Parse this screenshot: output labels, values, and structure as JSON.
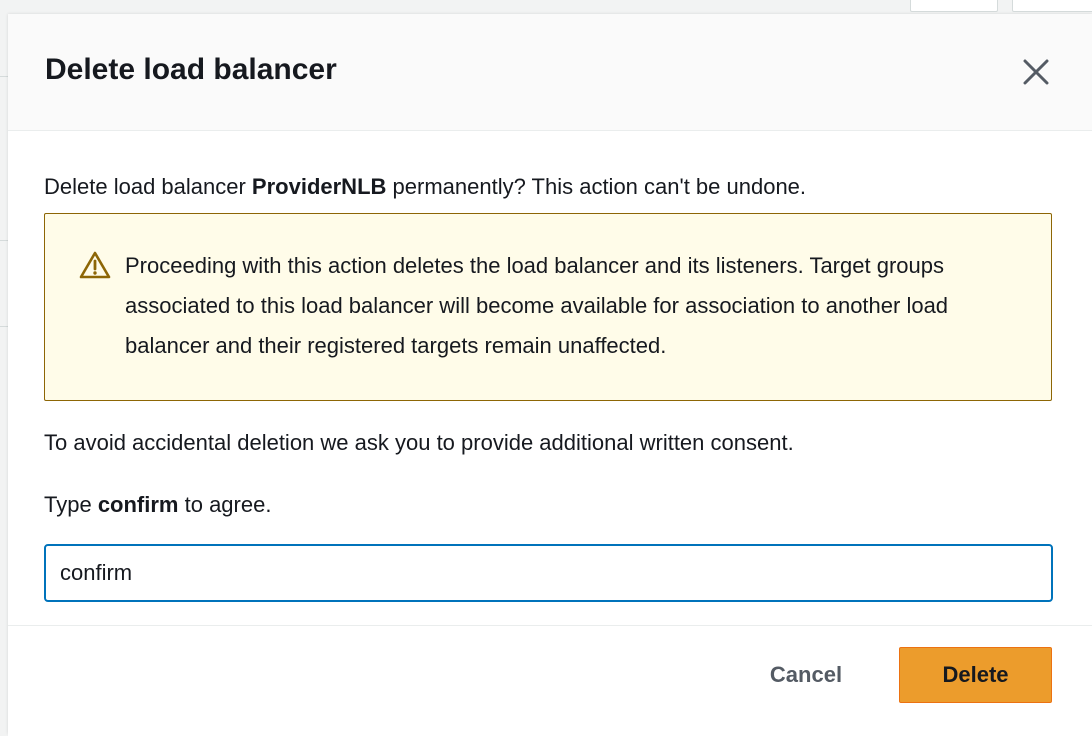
{
  "modal": {
    "title": "Delete load balancer",
    "close_icon": "close-icon",
    "intro_prefix": "Delete load balancer ",
    "load_balancer_name": "ProviderNLB",
    "intro_suffix": " permanently? This action can't be undone.",
    "warning": {
      "icon": "warning-icon",
      "color": "#8d6605",
      "background": "#fffce9",
      "text": "Proceeding with this action deletes the load balancer and its listeners. Target groups associated to this load balancer will become available for association to another load balancer and their registered targets remain unaffected."
    },
    "consent_text": "To avoid accidental deletion we ask you to provide additional written consent.",
    "type_prefix": "Type ",
    "type_keyword": "confirm",
    "type_suffix": " to agree.",
    "input_value": "confirm",
    "cancel_label": "Cancel",
    "delete_label": "Delete",
    "delete_color": "#ec9c2c",
    "focus_color": "#0073bb"
  }
}
